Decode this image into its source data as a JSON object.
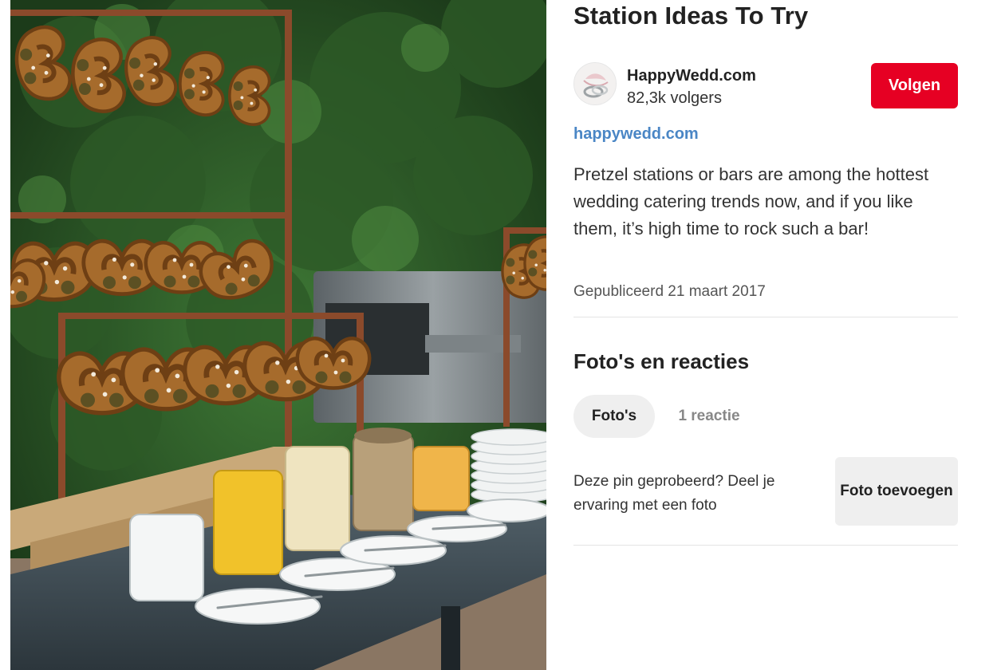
{
  "pin": {
    "title": "Station Ideas To Try",
    "image_icon": "pretzel-station-photo"
  },
  "creator": {
    "name": "HappyWedd.com",
    "followers": "82,3k volgers",
    "follow_label": "Volgen"
  },
  "source": {
    "domain": "happywedd.com"
  },
  "description": "Pretzel stations or bars are among the hottest wedding catering trends now, and if you like them, it’s high time to rock such a bar!",
  "published": "Gepubliceerd 21 maart 2017",
  "photos_section": {
    "title": "Foto's en reacties",
    "tabs": [
      {
        "label": "Foto's",
        "active": true
      },
      {
        "label": "1 reactie",
        "active": false
      }
    ],
    "tried_prompt": "Deze pin geprobeerd? Deel je ervaring met een foto",
    "add_photo_label": "Foto toevoegen"
  },
  "colors": {
    "follow_button": "#e60023",
    "link": "#4a86c5",
    "tab_active_bg": "#efefef"
  }
}
